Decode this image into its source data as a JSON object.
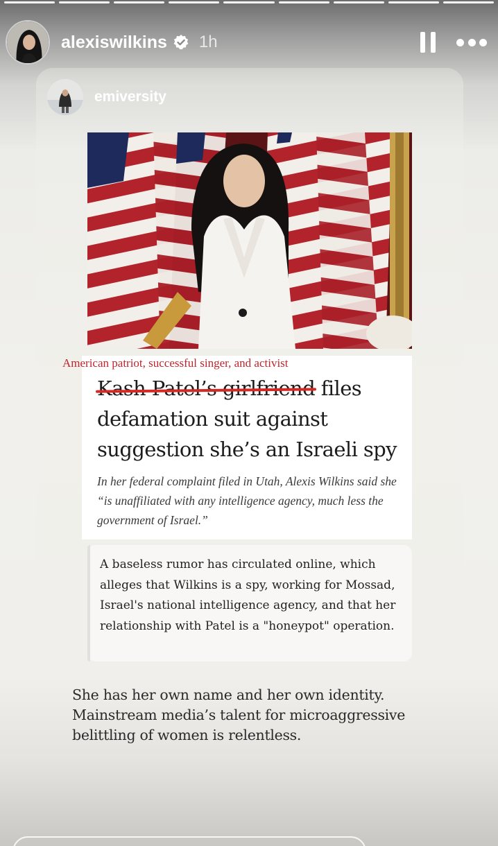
{
  "progress": {
    "segments": 9,
    "current": 0
  },
  "header": {
    "username": "alexiswilkins",
    "verified": true,
    "time": "1h",
    "pause_icon": "pause-icon",
    "more_icon": "more-icon"
  },
  "shared_post": {
    "username": "emiversity",
    "news": {
      "kicker": "American patriot, successful singer, and activist",
      "headline_struck": "Kash Patel’s girlfriend",
      "headline_rest_line1": " files",
      "headline_line2": "defamation suit against",
      "headline_line3": "suggestion she’s an Israeli spy",
      "dek": "In her federal complaint filed in Utah, Alexis Wilkins said she “is unaffiliated with any intelligence agency, much less the government of Israel.”"
    },
    "quote": "A baseless rumor has circulated online, which alleges that Wilkins is a spy, working for Mossad, Israel's national intelligence agency, and that her relationship with Patel is a \"honeypot\" operation.",
    "caption": "She has her own name and her own identity. Mainstream media’s talent for microaggressive belittling of women is relentless."
  },
  "colors": {
    "accent_red": "#d42a25",
    "kicker_red": "#c0242d"
  }
}
